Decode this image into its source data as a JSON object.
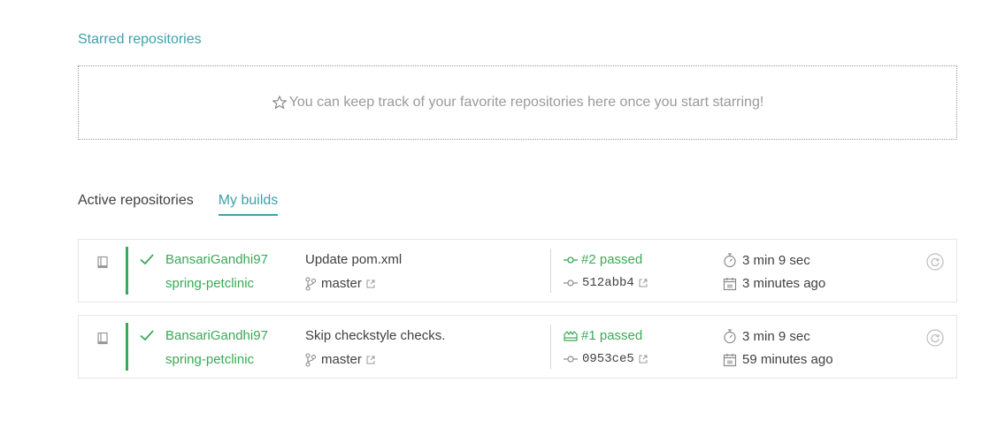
{
  "starred": {
    "title": "Starred repositories",
    "empty_message": "You can keep track of your favorite repositories here once you start starring!"
  },
  "tabs": [
    {
      "label": "Active repositories",
      "active": false
    },
    {
      "label": "My builds",
      "active": true
    }
  ],
  "builds": [
    {
      "owner": "BansariGandhi97",
      "repo": "spring-petclinic",
      "commit_message": "Update pom.xml",
      "branch": "master",
      "build_label": "#2 passed",
      "sha": "512abb4",
      "duration": "3 min 9 sec",
      "finished": "3 minutes ago",
      "state_icon": "commit-icon"
    },
    {
      "owner": "BansariGandhi97",
      "repo": "spring-petclinic",
      "commit_message": "Skip checkstyle checks.",
      "branch": "master",
      "build_label": "#1 passed",
      "sha": "0953ce5",
      "duration": "3 min 9 sec",
      "finished": "59 minutes ago",
      "state_icon": "push-icon"
    }
  ],
  "colors": {
    "accent": "#3fa1ab",
    "passed": "#39aa56",
    "text": "#404040",
    "muted": "#9a9a9a"
  }
}
